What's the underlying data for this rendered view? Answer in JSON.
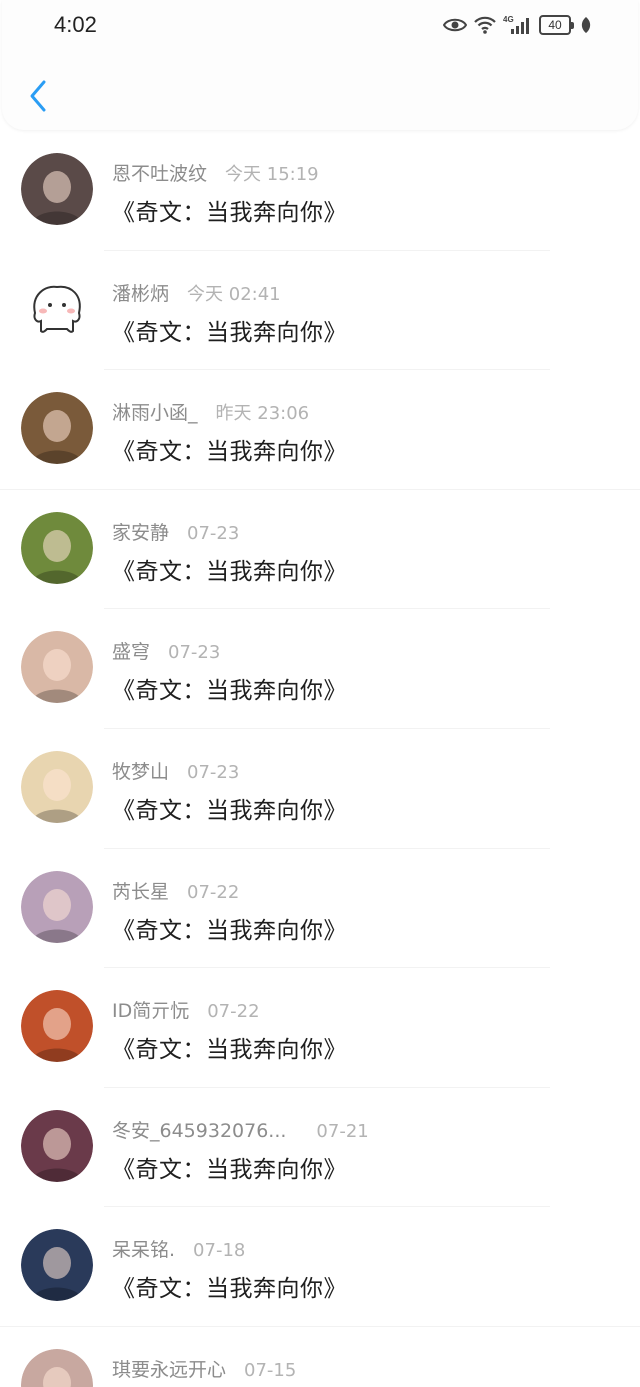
{
  "status_bar": {
    "time": "4:02",
    "network": "4G",
    "battery": "40"
  },
  "nav": {
    "back_icon": "chevron-left-icon",
    "accent": "#2a9df4"
  },
  "items": [
    {
      "name": "恩不吐波纹",
      "time": "今天 15:19",
      "title": "《奇文：当我奔向你》",
      "avatar_color": "#5a4a48"
    },
    {
      "name": "潘彬炳",
      "time": "今天 02:41",
      "title": "《奇文：当我奔向你》",
      "avatar_color": "#ffffff"
    },
    {
      "name": "淋雨小函_",
      "time": "昨天 23:06",
      "title": "《奇文：当我奔向你》",
      "avatar_color": "#7a5a3a"
    },
    {
      "name": "家安静",
      "time": "07-23",
      "title": "《奇文：当我奔向你》",
      "avatar_color": "#6f8a3c"
    },
    {
      "name": "盛穹",
      "time": "07-23",
      "title": "《奇文：当我奔向你》",
      "avatar_color": "#d9b8a6"
    },
    {
      "name": "牧梦山",
      "time": "07-23",
      "title": "《奇文：当我奔向你》",
      "avatar_color": "#e8d5b0"
    },
    {
      "name": "芮长星",
      "time": "07-22",
      "title": "《奇文：当我奔向你》",
      "avatar_color": "#b8a0b8"
    },
    {
      "name": "ID简亓忨",
      "time": "07-22",
      "title": "《奇文：当我奔向你》",
      "avatar_color": "#c0502a"
    },
    {
      "name": "冬安_645932076...",
      "time": "07-21",
      "title": "《奇文：当我奔向你》",
      "avatar_color": "#6a3a4a"
    },
    {
      "name": "呆呆铭.",
      "time": "07-18",
      "title": "《奇文：当我奔向你》",
      "avatar_color": "#2a3a5a"
    },
    {
      "name": "琪要永远开心",
      "time": "07-15",
      "title": "",
      "avatar_color": "#c8a8a0"
    }
  ]
}
